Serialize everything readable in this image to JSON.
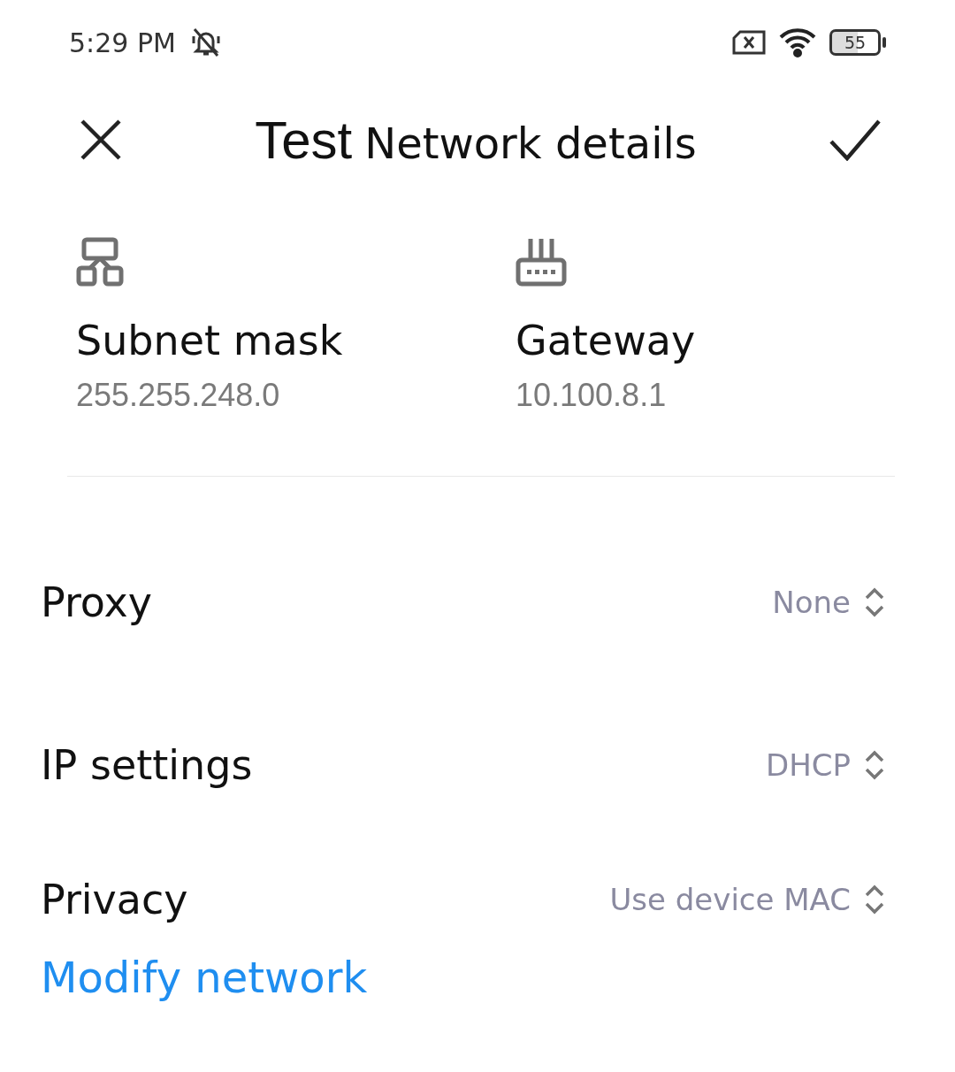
{
  "status_bar": {
    "time": "5:29 PM",
    "battery": "55"
  },
  "header": {
    "title_prefix": "Test",
    "title": "Network details"
  },
  "info": [
    {
      "kind": "subnet",
      "label": "Subnet mask",
      "value": "255.255.248.0"
    },
    {
      "kind": "gateway",
      "label": "Gateway",
      "value": "10.100.8.1"
    }
  ],
  "settings": [
    {
      "label": "Proxy",
      "value": "None"
    },
    {
      "label": "IP settings",
      "value": "DHCP"
    },
    {
      "label": "Privacy",
      "value": "Use device MAC"
    }
  ],
  "link": "Modify network"
}
